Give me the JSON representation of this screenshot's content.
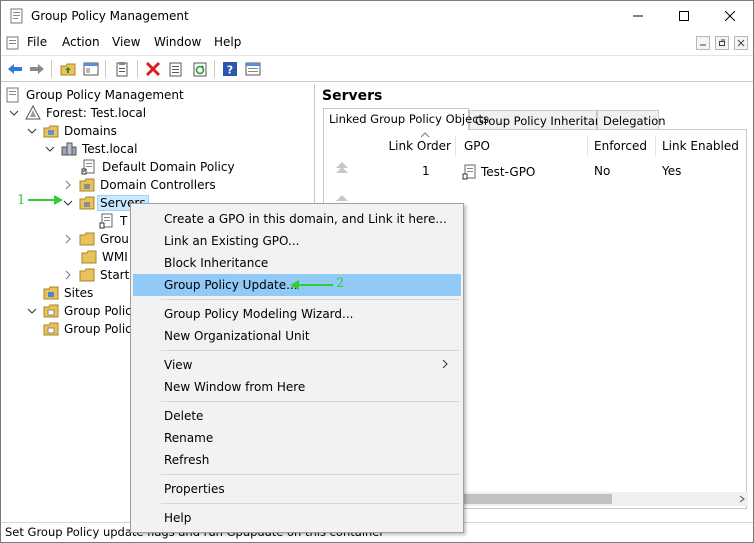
{
  "window": {
    "title": "Group Policy Management",
    "minimize_glyph": "—",
    "maximize_glyph": "☐",
    "close_glyph": "✕"
  },
  "menu": [
    "File",
    "Action",
    "View",
    "Window",
    "Help"
  ],
  "toolbar": {
    "buttons": [
      "back-icon",
      "forward-icon",
      "up-folder-icon",
      "show-tree-icon",
      "properties-icon",
      "delete-icon",
      "export-icon",
      "refresh-icon",
      "help-icon",
      "mmc-icon"
    ]
  },
  "tree": {
    "root": "Group Policy Management",
    "forest": "Forest: Test.local",
    "domains": "Domains",
    "domain": "Test.local",
    "default_policy": "Default Domain Policy",
    "domain_controllers": "Domain Controllers",
    "servers": "Servers",
    "servers_child": "T",
    "group_policy_objects_partial": "Grou",
    "wmi_partial": "WMI",
    "starter_partial": "Start",
    "sites": "Sites",
    "modeling_partial": "Group Policy",
    "results_partial": "Group Policy"
  },
  "panel": {
    "title": "Servers",
    "tabs": [
      "Linked Group Policy Objects",
      "Group Policy Inheritance",
      "Delegation"
    ],
    "columns": [
      "Link Order",
      "GPO",
      "Enforced",
      "Link Enabled"
    ],
    "rows": [
      {
        "link_order": "1",
        "gpo": "Test-GPO",
        "enforced": "No",
        "link_enabled": "Yes"
      }
    ]
  },
  "context_menu": {
    "items": [
      "Create a GPO in this domain, and Link it here...",
      "Link an Existing GPO...",
      "Block Inheritance",
      "Group Policy Update...",
      "Group Policy Modeling Wizard...",
      "New Organizational Unit",
      "View",
      "New Window from Here",
      "Delete",
      "Rename",
      "Refresh",
      "Properties",
      "Help"
    ],
    "highlighted": "Group Policy Update..."
  },
  "status_bar": "Set Group Policy update flags and run Gpupdate on this container",
  "annotations": {
    "step1": "1",
    "step2": "2",
    "color": "#33cc33"
  }
}
